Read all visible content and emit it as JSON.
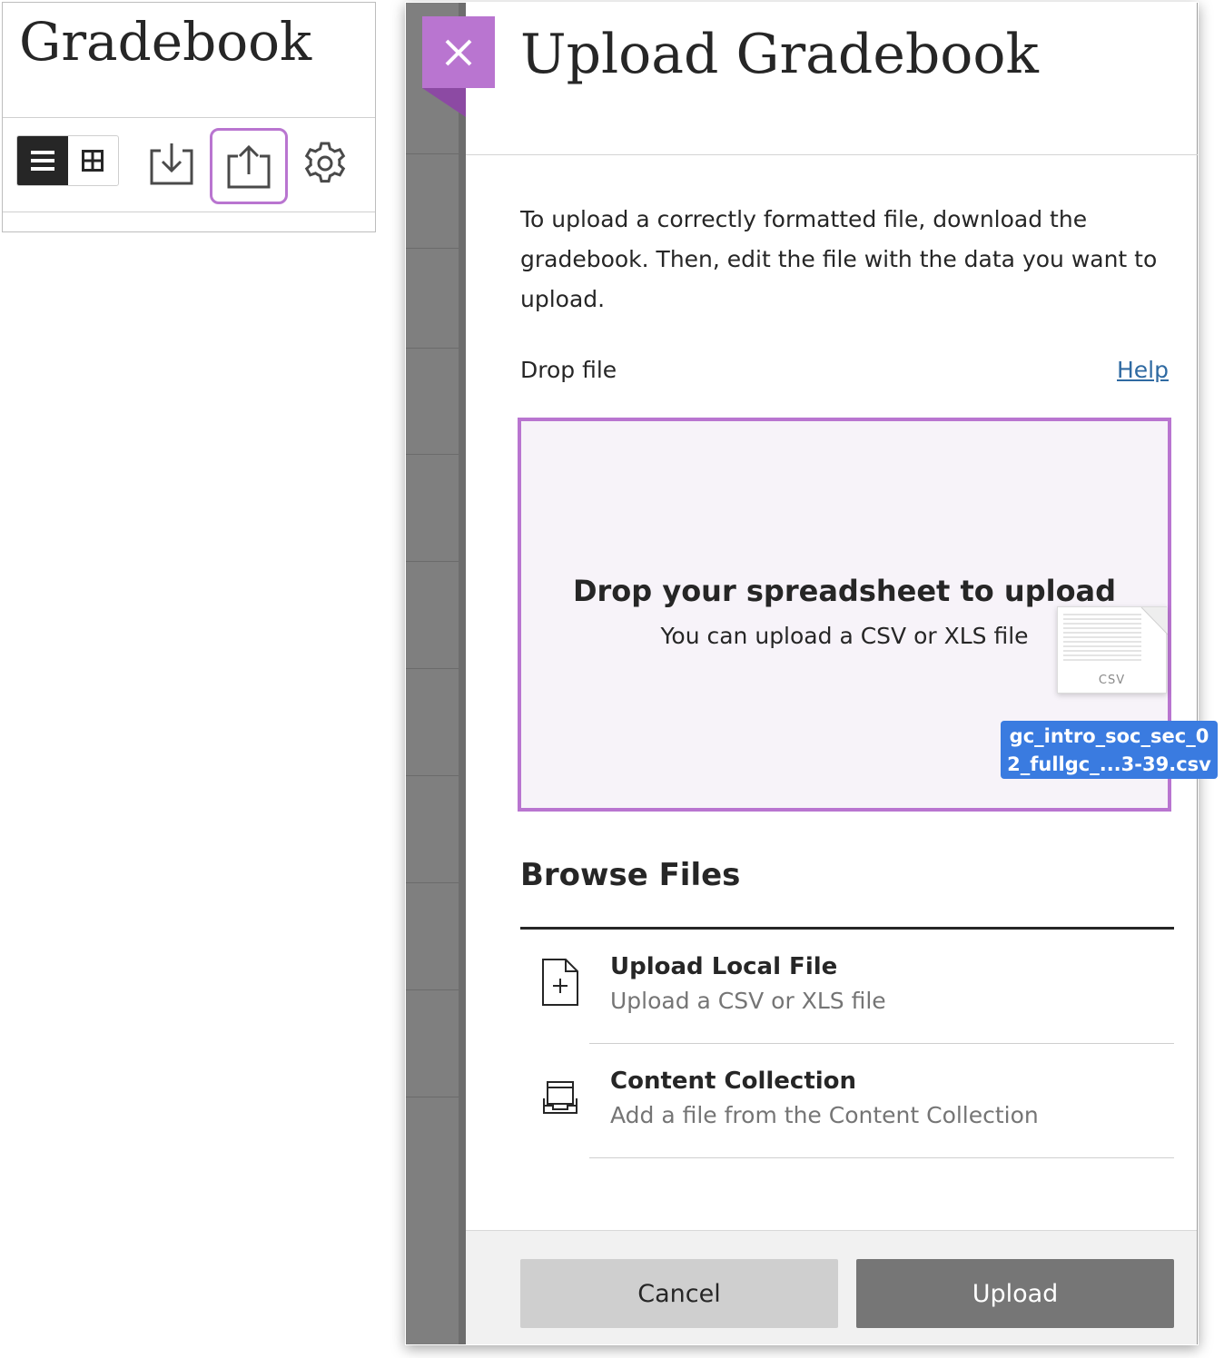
{
  "gradebook": {
    "title": "Gradebook",
    "icons": {
      "list_view": "list-view-icon",
      "grid_view": "grid-view-icon",
      "download": "download-icon",
      "upload": "upload-icon",
      "settings": "gear-icon"
    }
  },
  "panel": {
    "title": "Upload Gradebook",
    "close_icon": "close-icon",
    "intro": "To upload a correctly formatted file, download the gradebook. Then, edit the file with the data you want to upload.",
    "drop_label": "Drop file",
    "help_label": "Help",
    "dropzone": {
      "title": "Drop your spreadsheet to upload",
      "subtitle": "You can upload a CSV or XLS file"
    },
    "dragged_file": {
      "type_label": "CSV",
      "name_line1": "gc_intro_soc_sec_0",
      "name_line2": "2_fullgc_...3-39.csv"
    },
    "browse": {
      "title": "Browse Files",
      "options": [
        {
          "title": "Upload Local File",
          "description": "Upload a CSV or XLS file",
          "icon": "file-plus-icon"
        },
        {
          "title": "Content Collection",
          "description": "Add a file from the Content Collection",
          "icon": "content-collection-icon"
        }
      ]
    },
    "buttons": {
      "cancel": "Cancel",
      "upload": "Upload"
    }
  },
  "colors": {
    "accent": "#b975d0",
    "dropzone_bg": "#f7f3f9",
    "link": "#2f6aa2",
    "selection": "#3a7be0",
    "dark": "#262626"
  }
}
